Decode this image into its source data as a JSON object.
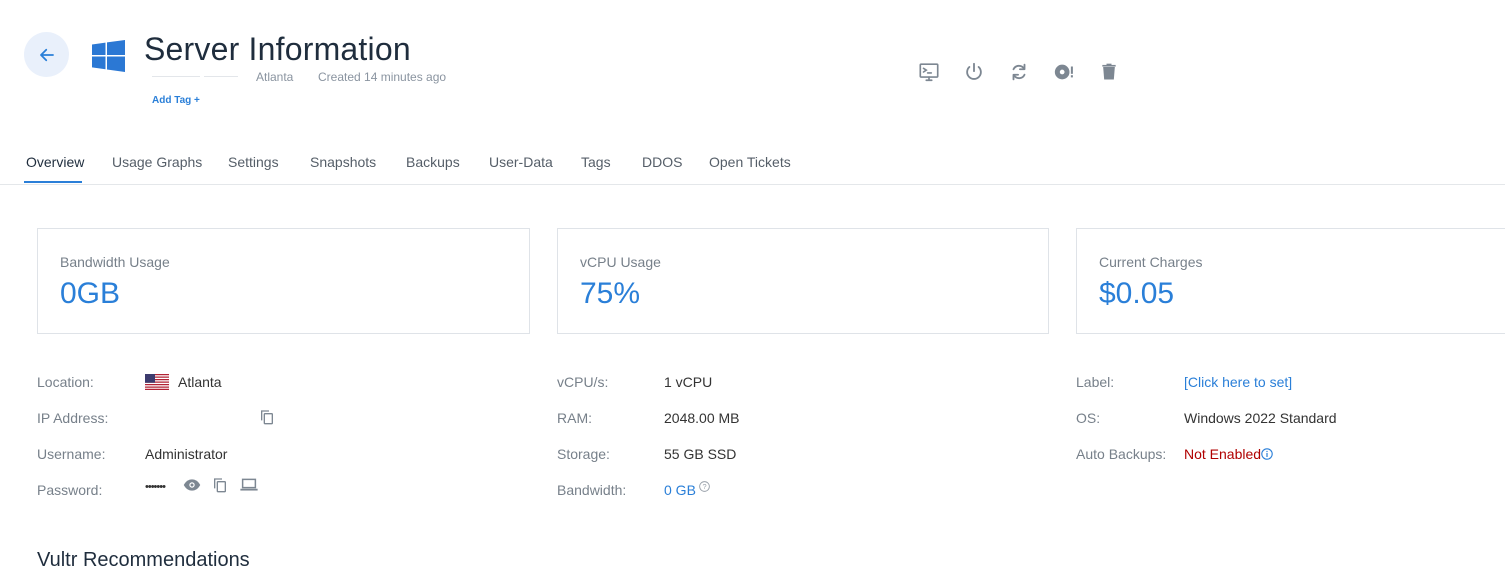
{
  "header": {
    "title": "Server Information",
    "location": "Atlanta",
    "created": "Created 14 minutes ago",
    "add_tag": "Add Tag +"
  },
  "tabs": [
    {
      "label": "Overview",
      "active": true
    },
    {
      "label": "Usage Graphs"
    },
    {
      "label": "Settings"
    },
    {
      "label": "Snapshots"
    },
    {
      "label": "Backups"
    },
    {
      "label": "User-Data"
    },
    {
      "label": "Tags"
    },
    {
      "label": "DDOS"
    },
    {
      "label": "Open Tickets"
    }
  ],
  "cards": {
    "bandwidth": {
      "label": "Bandwidth Usage",
      "value": "0GB"
    },
    "vcpu": {
      "label": "vCPU Usage",
      "value": "75%"
    },
    "charges": {
      "label": "Current Charges",
      "value": "$0.05"
    }
  },
  "info_left": {
    "location_label": "Location:",
    "location_value": "Atlanta",
    "ip_label": "IP Address:",
    "username_label": "Username:",
    "username_value": "Administrator",
    "password_label": "Password:",
    "password_value": "•••••••"
  },
  "info_mid": {
    "vcpus_label": "vCPU/s:",
    "vcpus_value": "1 vCPU",
    "ram_label": "RAM:",
    "ram_value": "2048.00 MB",
    "storage_label": "Storage:",
    "storage_value": "55 GB SSD",
    "bandwidth_label": "Bandwidth:",
    "bandwidth_value": "0 GB"
  },
  "info_right": {
    "label_label": "Label:",
    "label_value": "[Click here to set]",
    "os_label": "OS:",
    "os_value": "Windows 2022 Standard",
    "backups_label": "Auto Backups:",
    "backups_value": "Not Enabled"
  },
  "section_title_partial": "Vultr Recommendations",
  "colors": {
    "accent": "#2a7fd8",
    "warning": "#b00000",
    "windows": "#2b78d4"
  },
  "icons": [
    "arrow-left-icon",
    "windows-logo-icon",
    "console-icon",
    "power-icon",
    "restart-icon",
    "reinstall-icon",
    "trash-icon",
    "copy-icon",
    "eye-icon",
    "laptop-icon",
    "info-icon",
    "help-icon",
    "us-flag-icon"
  ]
}
